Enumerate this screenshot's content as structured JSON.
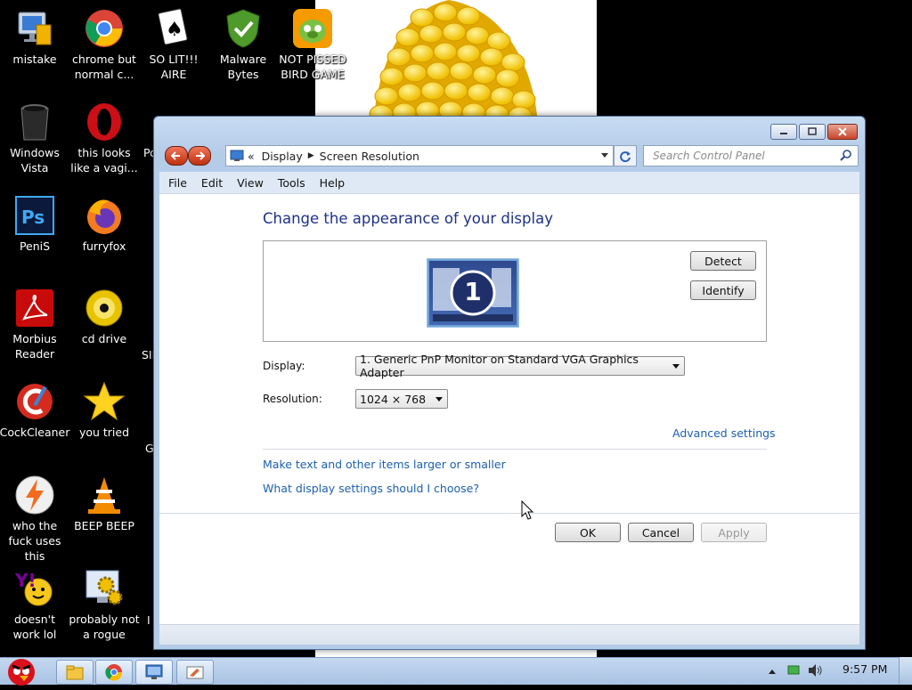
{
  "desktop": {
    "icons": [
      {
        "label": "mistake",
        "icon": "computer-icon"
      },
      {
        "label": "chrome but normal c...",
        "icon": "chrome-icon"
      },
      {
        "label": "SO LIT!!! AIRE",
        "icon": "solitaire-icon"
      },
      {
        "label": "Malware Bytes",
        "icon": "shield-check-icon"
      },
      {
        "label": "NOT PISSED BIRD GAME",
        "icon": "bird-game-icon"
      },
      {
        "label": "Windows Vista",
        "icon": "trash-can-icon"
      },
      {
        "label": "this looks like a vagi...",
        "icon": "opera-icon"
      },
      {
        "label": "PeniS",
        "icon": "photoshop-icon"
      },
      {
        "label": "furryfox",
        "icon": "firefox-icon"
      },
      {
        "label": "Morbius Reader",
        "icon": "acrobat-icon"
      },
      {
        "label": "cd drive",
        "icon": "cd-icon"
      },
      {
        "label": "CockCleaner",
        "icon": "ccleaner-icon"
      },
      {
        "label": "you tried",
        "icon": "star-icon"
      },
      {
        "label": "who the fuck uses this",
        "icon": "winamp-icon"
      },
      {
        "label": "BEEP BEEP",
        "icon": "vlc-cone-icon"
      },
      {
        "label": "doesn't work lol",
        "icon": "yahoo-messenger-icon"
      },
      {
        "label": "probably not a rogue",
        "icon": "settings-gears-icon"
      }
    ],
    "partial_labels": [
      "Po",
      "SII",
      "G",
      "I"
    ]
  },
  "window": {
    "breadcrumb": [
      "Display",
      "Screen Resolution"
    ],
    "breadcrumb_prefix": "«",
    "search_placeholder": "Search Control Panel",
    "menu": [
      "File",
      "Edit",
      "View",
      "Tools",
      "Help"
    ],
    "heading": "Change the appearance of your display",
    "monitor_number": "1",
    "detect_label": "Detect",
    "identify_label": "Identify",
    "display_label": "Display:",
    "display_value": "1. Generic PnP Monitor on Standard VGA Graphics Adapter",
    "resolution_label": "Resolution:",
    "resolution_value": "1024 × 768",
    "advanced_link": "Advanced settings",
    "link_text_size": "Make text and other items larger or smaller",
    "link_which_settings": "What display settings should I choose?",
    "ok_label": "OK",
    "cancel_label": "Cancel",
    "apply_label": "Apply"
  },
  "taskbar": {
    "clock": "9:57 PM",
    "items": [
      "angry-bird-start-icon",
      "explorer-folder-icon",
      "chrome-icon",
      "control-panel-icon",
      "paint-icon"
    ]
  },
  "colors": {
    "heading": "#1e3287",
    "link": "#1c5fb0",
    "window_frame": "#b5cce8"
  }
}
